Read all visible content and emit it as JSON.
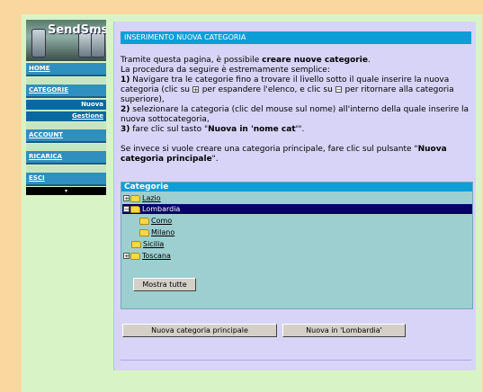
{
  "logo": {
    "brand": "SendSms"
  },
  "nav": {
    "home": "HOME",
    "categorie": "CATEGORIE",
    "sub_nuova": "Nuova",
    "sub_gestione": "Gestione",
    "account": "ACCOUNT",
    "ricarica": "RICARICA",
    "esci": "ESCI",
    "bottom_marker": "▾"
  },
  "header": {
    "title": "INSERIMENTO NUOVA CATEGORIA"
  },
  "intro": {
    "l1a": "Tramite questa pagina, è possibile ",
    "l1b": "creare nuove categorie",
    "l1c": ".",
    "l2": "La procedura da seguire è estremamente semplice:",
    "s1n": "1)",
    "s1a": " Navigare tra le categorie fino a trovare il livello sotto il quale inserire la nuova categoria (clic su ",
    "s1b": " per espandere l'elenco, e clic su ",
    "s1c": " per ritornare alla categoria superiore),",
    "s2n": "2)",
    "s2a": " selezionare la categoria (clic del mouse sul nome) all'interno della quale inserire la nuova sottocategoria,",
    "s3n": "3)",
    "s3a": " fare clic sul tasto \"",
    "s3b": "Nuova in 'nome cat'",
    "s3c": "\".",
    "p2a": "Se invece si vuole creare una categoria principale, fare clic sul pulsante \"",
    "p2b": "Nuova categoria principale",
    "p2c": "\"."
  },
  "tree": {
    "title": "Categorie",
    "items": [
      {
        "label": "Lazio",
        "toggle": "+"
      },
      {
        "label": "Lombardia",
        "toggle": "-"
      },
      {
        "label": "Como"
      },
      {
        "label": "Milano"
      },
      {
        "label": "Sicilia"
      },
      {
        "label": "Toscana",
        "toggle": "+"
      }
    ],
    "show_all": "Mostra tutte"
  },
  "buttons": {
    "new_main": "Nuova categoria principale",
    "new_in": "Nuova in 'Lombardia'"
  }
}
